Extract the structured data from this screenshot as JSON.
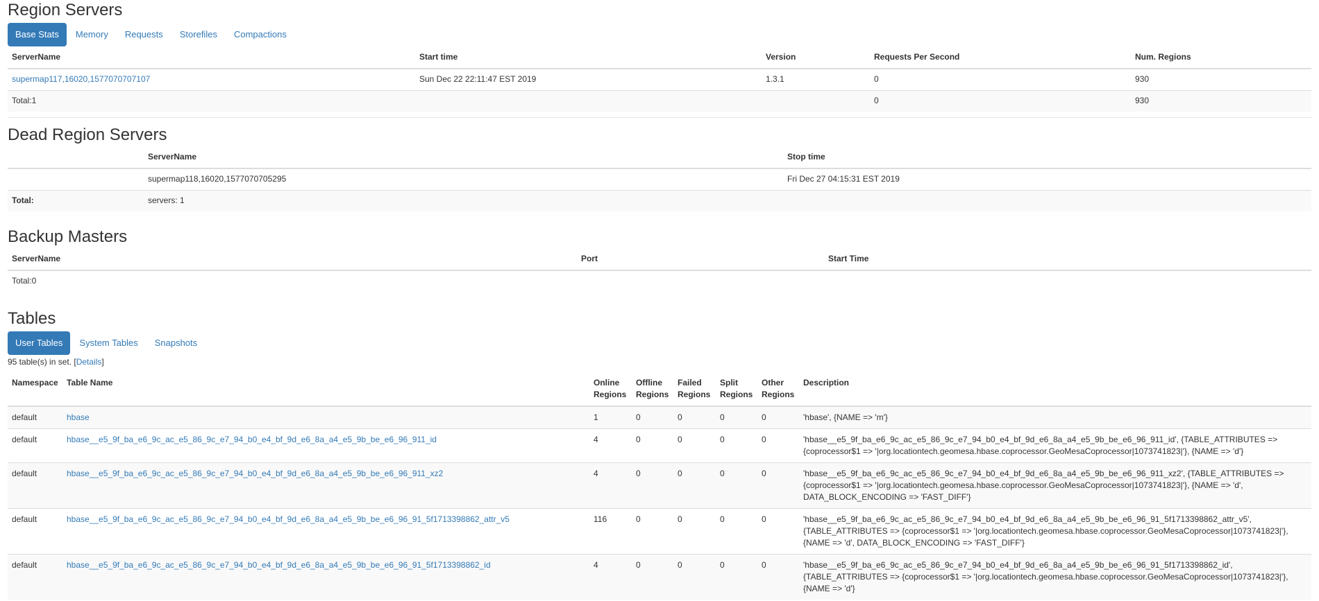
{
  "region_servers": {
    "title": "Region Servers",
    "tabs": [
      "Base Stats",
      "Memory",
      "Requests",
      "Storefiles",
      "Compactions"
    ],
    "columns": [
      "ServerName",
      "Start time",
      "Version",
      "Requests Per Second",
      "Num. Regions"
    ],
    "rows": [
      {
        "server": "supermap117,16020,1577070707107",
        "start": "Sun Dec 22 22:11:47 EST 2019",
        "version": "1.3.1",
        "rps": "0",
        "regions": "930"
      }
    ],
    "total": {
      "label": "Total:1",
      "rps": "0",
      "regions": "930"
    }
  },
  "dead_region_servers": {
    "title": "Dead Region Servers",
    "columns": [
      "",
      "ServerName",
      "Stop time"
    ],
    "rows": [
      {
        "server": "supermap118,16020,1577070705295",
        "stop": "Fri Dec 27 04:15:31 EST 2019"
      }
    ],
    "total": {
      "label": "Total:",
      "value": "servers: 1"
    }
  },
  "backup_masters": {
    "title": "Backup Masters",
    "columns": [
      "ServerName",
      "Port",
      "Start Time"
    ],
    "total": "Total:0"
  },
  "tables": {
    "title": "Tables",
    "tabs": [
      "User Tables",
      "System Tables",
      "Snapshots"
    ],
    "count_prefix": "95 table(s) in set. [",
    "details_link": "Details",
    "count_suffix": "]",
    "columns": [
      "Namespace",
      "Table Name",
      "Online Regions",
      "Offline Regions",
      "Failed Regions",
      "Split Regions",
      "Other Regions",
      "Description"
    ],
    "rows": [
      {
        "ns": "default",
        "name": "hbase",
        "online": "1",
        "offline": "0",
        "failed": "0",
        "split": "0",
        "other": "0",
        "desc": "'hbase', {NAME => 'm'}"
      },
      {
        "ns": "default",
        "name": "hbase__e5_9f_ba_e6_9c_ac_e5_86_9c_e7_94_b0_e4_bf_9d_e6_8a_a4_e5_9b_be_e6_96_911_id",
        "online": "4",
        "offline": "0",
        "failed": "0",
        "split": "0",
        "other": "0",
        "desc": "'hbase__e5_9f_ba_e6_9c_ac_e5_86_9c_e7_94_b0_e4_bf_9d_e6_8a_a4_e5_9b_be_e6_96_911_id', {TABLE_ATTRIBUTES => {coprocessor$1 => '|org.locationtech.geomesa.hbase.coprocessor.GeoMesaCoprocessor|1073741823|'}, {NAME => 'd'}"
      },
      {
        "ns": "default",
        "name": "hbase__e5_9f_ba_e6_9c_ac_e5_86_9c_e7_94_b0_e4_bf_9d_e6_8a_a4_e5_9b_be_e6_96_911_xz2",
        "online": "4",
        "offline": "0",
        "failed": "0",
        "split": "0",
        "other": "0",
        "desc": "'hbase__e5_9f_ba_e6_9c_ac_e5_86_9c_e7_94_b0_e4_bf_9d_e6_8a_a4_e5_9b_be_e6_96_911_xz2', {TABLE_ATTRIBUTES => {coprocessor$1 => '|org.locationtech.geomesa.hbase.coprocessor.GeoMesaCoprocessor|1073741823|'}, {NAME => 'd', DATA_BLOCK_ENCODING => 'FAST_DIFF'}"
      },
      {
        "ns": "default",
        "name": "hbase__e5_9f_ba_e6_9c_ac_e5_86_9c_e7_94_b0_e4_bf_9d_e6_8a_a4_e5_9b_be_e6_96_91_5f1713398862_attr_v5",
        "online": "116",
        "offline": "0",
        "failed": "0",
        "split": "0",
        "other": "0",
        "desc": "'hbase__e5_9f_ba_e6_9c_ac_e5_86_9c_e7_94_b0_e4_bf_9d_e6_8a_a4_e5_9b_be_e6_96_91_5f1713398862_attr_v5', {TABLE_ATTRIBUTES => {coprocessor$1 => '|org.locationtech.geomesa.hbase.coprocessor.GeoMesaCoprocessor|1073741823|'}, {NAME => 'd', DATA_BLOCK_ENCODING => 'FAST_DIFF'}"
      },
      {
        "ns": "default",
        "name": "hbase__e5_9f_ba_e6_9c_ac_e5_86_9c_e7_94_b0_e4_bf_9d_e6_8a_a4_e5_9b_be_e6_96_91_5f1713398862_id",
        "online": "4",
        "offline": "0",
        "failed": "0",
        "split": "0",
        "other": "0",
        "desc": "'hbase__e5_9f_ba_e6_9c_ac_e5_86_9c_e7_94_b0_e4_bf_9d_e6_8a_a4_e5_9b_be_e6_96_91_5f1713398862_id', {TABLE_ATTRIBUTES => {coprocessor$1 => '|org.locationtech.geomesa.hbase.coprocessor.GeoMesaCoprocessor|1073741823|'}, {NAME => 'd'}"
      }
    ]
  },
  "colors": {
    "accent": "#337ab7",
    "stripe": "#f9f9f9",
    "border": "#dddddd"
  }
}
